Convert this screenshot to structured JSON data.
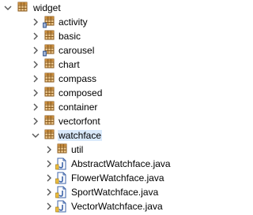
{
  "tree": {
    "root": {
      "label": "widget"
    },
    "children": [
      {
        "label": "activity"
      },
      {
        "label": "basic"
      },
      {
        "label": "carousel"
      },
      {
        "label": "chart"
      },
      {
        "label": "compass"
      },
      {
        "label": "composed"
      },
      {
        "label": "container"
      },
      {
        "label": "vectorfont"
      },
      {
        "label": "watchface"
      }
    ],
    "watchface_children": [
      {
        "label": "util"
      },
      {
        "label": "AbstractWatchface.java"
      },
      {
        "label": "FlowerWatchface.java"
      },
      {
        "label": "SportWatchface.java"
      },
      {
        "label": "VectorWatchface.java"
      }
    ]
  },
  "colors": {
    "package_icon": "#b5772a",
    "java_file_icon": "#3d63a8",
    "chevron": "#555555"
  }
}
